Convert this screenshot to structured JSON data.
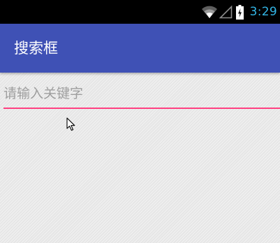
{
  "status_bar": {
    "time": "3:29",
    "icons": [
      "wifi-icon",
      "signal-icon",
      "battery-charging-icon"
    ],
    "clock_color": "#33b5e5"
  },
  "app_bar": {
    "title": "搜索框",
    "color": "#3f51b5"
  },
  "search": {
    "placeholder": "请输入关键字",
    "value": "",
    "underline_color": "#ff4081"
  }
}
